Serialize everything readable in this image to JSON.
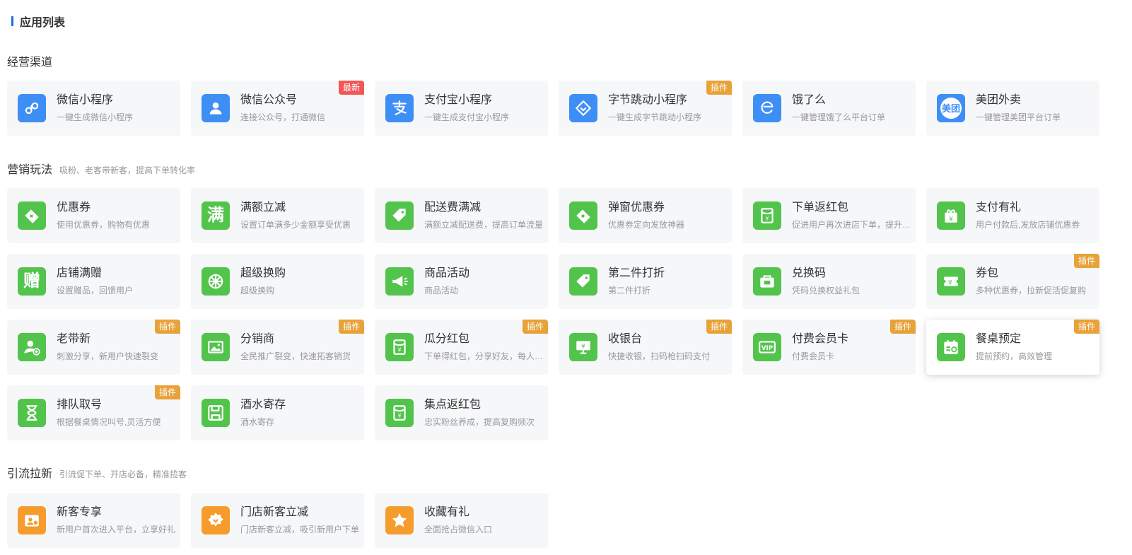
{
  "page": {
    "title": "应用列表"
  },
  "colors": {
    "blue": "#3d8ef5",
    "green": "#52c44c",
    "orange": "#f59c2c",
    "badge_new": "#f25757",
    "badge_plugin": "#e8a23a"
  },
  "sections": [
    {
      "id": "channels",
      "title": "经营渠道",
      "desc": "",
      "items": [
        {
          "id": "wechat-mini",
          "icon": "mini-program-icon",
          "color": "#3d8ef5",
          "title": "微信小程序",
          "desc": "一键生成微信小程序",
          "badge": ""
        },
        {
          "id": "wechat-official",
          "icon": "official-account-icon",
          "color": "#3d8ef5",
          "title": "微信公众号",
          "desc": "连接公众号，打通微信",
          "badge": "最新",
          "badge_color": "#f25757"
        },
        {
          "id": "alipay-mini",
          "icon": "alipay-icon",
          "color": "#3d8ef5",
          "title": "支付宝小程序",
          "desc": "一键生成支付宝小程序",
          "badge": ""
        },
        {
          "id": "bytedance-mini",
          "icon": "bytedance-icon",
          "color": "#3d8ef5",
          "title": "字节跳动小程序",
          "desc": "一键生成字节跳动小程序",
          "badge": "插件",
          "badge_color": "#e8a23a"
        },
        {
          "id": "eleme",
          "icon": "eleme-icon",
          "color": "#3d8ef5",
          "title": "饿了么",
          "desc": "一键管理饿了么平台订单",
          "badge": ""
        },
        {
          "id": "meituan",
          "icon": "meituan-icon",
          "color": "#3d8ef5",
          "title": "美团外卖",
          "desc": "一键管理美团平台订单",
          "badge": "",
          "icon_text": "美团"
        }
      ]
    },
    {
      "id": "marketing",
      "title": "营销玩法",
      "desc": "吸粉、老客带新客，提高下单转化率",
      "items": [
        {
          "id": "coupon",
          "icon": "coupon-icon",
          "color": "#52c44c",
          "title": "优惠券",
          "desc": "使用优惠券，购物有优惠",
          "badge": ""
        },
        {
          "id": "full-reduction",
          "icon": "full-reduction-icon",
          "color": "#52c44c",
          "title": "满额立减",
          "desc": "设置订单满多少金额享受优惠",
          "badge": "",
          "icon_text": "满"
        },
        {
          "id": "delivery-reduction",
          "icon": "price-tag-icon",
          "color": "#52c44c",
          "title": "配送费满减",
          "desc": "满额立减配送费，提高订单流量",
          "badge": ""
        },
        {
          "id": "popup-coupon",
          "icon": "coupon-icon",
          "color": "#52c44c",
          "title": "弹窗优惠券",
          "desc": "优惠券定向发放神器",
          "badge": ""
        },
        {
          "id": "order-redpacket",
          "icon": "red-packet-icon",
          "color": "#52c44c",
          "title": "下单返红包",
          "desc": "促进用户再次进店下单，提升复购",
          "badge": ""
        },
        {
          "id": "pay-gift",
          "icon": "gift-icon",
          "color": "#52c44c",
          "title": "支付有礼",
          "desc": "用户付款后,发放店铺优惠券",
          "badge": ""
        },
        {
          "id": "store-gift",
          "icon": "gift-text-icon",
          "color": "#52c44c",
          "title": "店铺满赠",
          "desc": "设置赠品，回馈用户",
          "badge": "",
          "icon_text": "赠"
        },
        {
          "id": "super-exchange",
          "icon": "wheel-icon",
          "color": "#52c44c",
          "title": "超级换购",
          "desc": "超级换购",
          "badge": ""
        },
        {
          "id": "goods-activity",
          "icon": "megaphone-icon",
          "color": "#52c44c",
          "title": "商品活动",
          "desc": "商品活动",
          "badge": ""
        },
        {
          "id": "second-discount",
          "icon": "price-tag-icon",
          "color": "#52c44c",
          "title": "第二件打折",
          "desc": "第二件打折",
          "badge": ""
        },
        {
          "id": "redeem-code",
          "icon": "redeem-icon",
          "color": "#52c44c",
          "title": "兑换码",
          "desc": "凭码兑换权益礼包",
          "badge": ""
        },
        {
          "id": "coupon-pack",
          "icon": "ticket-icon",
          "color": "#52c44c",
          "title": "券包",
          "desc": "多种优惠券，拉新促活促复购",
          "badge": "插件",
          "badge_color": "#e8a23a"
        },
        {
          "id": "old-bring-new",
          "icon": "user-add-icon",
          "color": "#52c44c",
          "title": "老带新",
          "desc": "刺激分享，新用户快速裂变",
          "badge": "插件",
          "badge_color": "#e8a23a"
        },
        {
          "id": "distributor",
          "icon": "image-icon",
          "color": "#52c44c",
          "title": "分销商",
          "desc": "全民推广裂变，快速拓客销货",
          "badge": "插件",
          "badge_color": "#e8a23a"
        },
        {
          "id": "split-redpacket",
          "icon": "red-packet-icon",
          "color": "#52c44c",
          "title": "瓜分红包",
          "desc": "下单得红包，分享好友，每人都有",
          "badge": "插件",
          "badge_color": "#e8a23a"
        },
        {
          "id": "cashier",
          "icon": "monitor-icon",
          "color": "#52c44c",
          "title": "收银台",
          "desc": "快捷收银，扫码枪扫码支付",
          "badge": "插件",
          "badge_color": "#e8a23a"
        },
        {
          "id": "paid-member",
          "icon": "vip-card-icon",
          "color": "#52c44c",
          "title": "付费会员卡",
          "desc": "付费会员卡",
          "badge": "插件",
          "badge_color": "#e8a23a"
        },
        {
          "id": "table-booking",
          "icon": "calendar-icon",
          "color": "#52c44c",
          "title": "餐桌预定",
          "desc": "提前预约，高效管理",
          "badge": "插件",
          "badge_color": "#e8a23a",
          "hovered": true
        },
        {
          "id": "queue",
          "icon": "hourglass-icon",
          "color": "#52c44c",
          "title": "排队取号",
          "desc": "根据餐桌情况叫号,灵活方便",
          "badge": "插件",
          "badge_color": "#e8a23a"
        },
        {
          "id": "wine-storage",
          "icon": "save-icon",
          "color": "#52c44c",
          "title": "酒水寄存",
          "desc": "酒水寄存",
          "badge": ""
        },
        {
          "id": "collect-redpacket",
          "icon": "red-packet-icon",
          "color": "#52c44c",
          "title": "集点返红包",
          "desc": "忠实粉丝养成，提高复购频次",
          "badge": ""
        }
      ]
    },
    {
      "id": "traffic",
      "title": "引流拉新",
      "desc": "引流促下单、开店必备，精准揽客",
      "items": [
        {
          "id": "new-customer",
          "icon": "new-user-icon",
          "color": "#f59c2c",
          "title": "新客专享",
          "desc": "新用户首次进入平台，立享好礼",
          "badge": ""
        },
        {
          "id": "store-new-reduction",
          "icon": "flower-badge-icon",
          "color": "#f59c2c",
          "title": "门店新客立减",
          "desc": "门店新客立减，吸引新用户下单",
          "badge": ""
        },
        {
          "id": "favorite-gift",
          "icon": "star-icon",
          "color": "#f59c2c",
          "title": "收藏有礼",
          "desc": "全面抢占微信入口",
          "badge": ""
        }
      ]
    }
  ]
}
